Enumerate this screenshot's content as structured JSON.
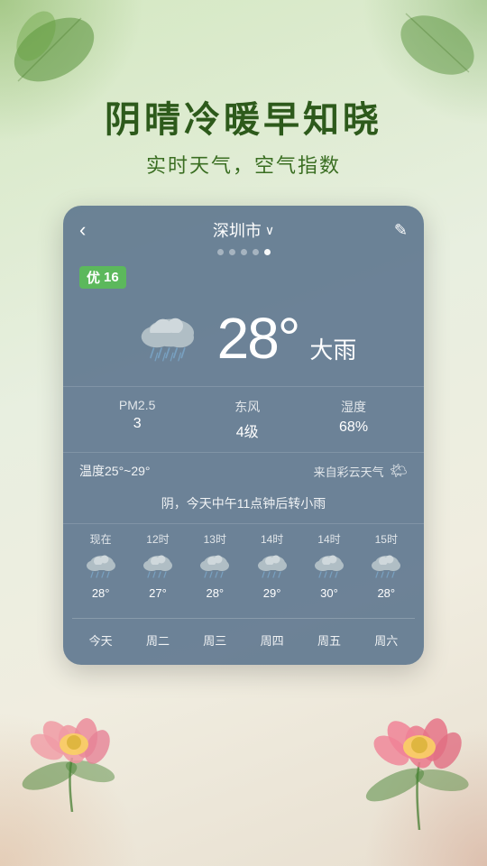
{
  "app": {
    "headline": "阴晴冷暖早知晓",
    "subheadline": "实时天气，空气指数"
  },
  "header": {
    "back_label": "‹",
    "city": "深圳市",
    "city_arrow": "∨",
    "edit_icon": "✎"
  },
  "dots": [
    {
      "active": false
    },
    {
      "active": false
    },
    {
      "active": false
    },
    {
      "active": false
    },
    {
      "active": true
    }
  ],
  "aqi": {
    "label": "优",
    "value": "16"
  },
  "main_weather": {
    "temperature": "28°",
    "condition": "大雨"
  },
  "stats": [
    {
      "label": "PM2.5",
      "value": "3"
    },
    {
      "label": "东风",
      "value": "4级"
    },
    {
      "label": "湿度",
      "value": "68%"
    }
  ],
  "temp_range": {
    "label": "温度25°~29°"
  },
  "source": {
    "label": "来自彩云天气"
  },
  "description": "阴，今天中午11点钟后转小雨",
  "hourly": {
    "labels": [
      "现在",
      "12时",
      "13时",
      "14时",
      "14时",
      "15时"
    ],
    "temps": [
      "28°",
      "27°",
      "28°",
      "29°",
      "30°",
      "28°"
    ]
  },
  "daily": {
    "labels": [
      "今天",
      "周二",
      "周三",
      "周四",
      "周五",
      "周六"
    ]
  }
}
